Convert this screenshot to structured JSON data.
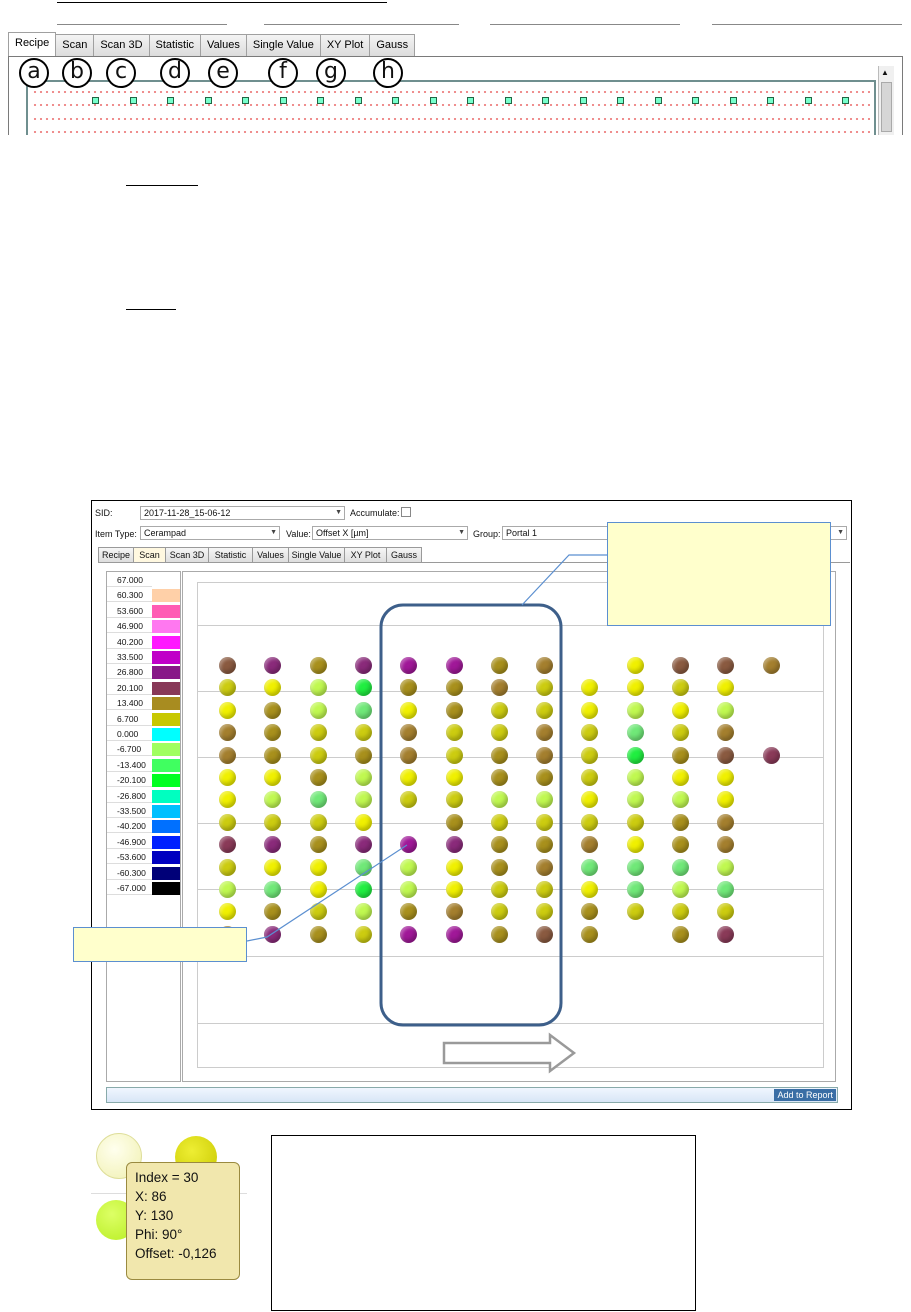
{
  "top_panel": {
    "tabs": [
      "Recipe",
      "Scan",
      "Scan 3D",
      "Statistic",
      "Values",
      "Single Value",
      "XY Plot",
      "Gauss"
    ],
    "active_tab": "Recipe",
    "markers": [
      "a",
      "b",
      "c",
      "d",
      "e",
      "f",
      "g",
      "h"
    ]
  },
  "screenshot": {
    "sid_label": "SID:",
    "sid_value": "2017-11-28_15-06-12",
    "accumulate_label": "Accumulate:",
    "item_type_label": "Item Type:",
    "item_type_value": "Cerampad",
    "value_label": "Value:",
    "value_value": "Offset X [µm]",
    "group_label": "Group:",
    "group_value": "Portal 1",
    "tabs": [
      "Recipe",
      "Scan",
      "Scan 3D",
      "Statistic",
      "Values",
      "Single Value",
      "XY Plot",
      "Gauss"
    ],
    "active_tab": "Scan",
    "add_to_report": "Add to Report",
    "scale": [
      {
        "label": "67.000",
        "color": "#ffffff"
      },
      {
        "label": "60.300",
        "color": "#ffd0a8"
      },
      {
        "label": "53.600",
        "color": "#ff5cb4"
      },
      {
        "label": "46.900",
        "color": "#ff78f0"
      },
      {
        "label": "40.200",
        "color": "#ff18ff"
      },
      {
        "label": "33.500",
        "color": "#c000c8"
      },
      {
        "label": "26.800",
        "color": "#881888"
      },
      {
        "label": "20.100",
        "color": "#883858"
      },
      {
        "label": "13.400",
        "color": "#a88c20"
      },
      {
        "label": "6.700",
        "color": "#c8c800"
      },
      {
        "label": "0.000",
        "color": "#00ffff"
      },
      {
        "label": "-6.700",
        "color": "#a0ff60"
      },
      {
        "label": "-13.400",
        "color": "#40ff60"
      },
      {
        "label": "-20.100",
        "color": "#00ff20"
      },
      {
        "label": "-26.800",
        "color": "#00ffc0"
      },
      {
        "label": "-33.500",
        "color": "#00c0ff"
      },
      {
        "label": "-40.200",
        "color": "#0070ff"
      },
      {
        "label": "-46.900",
        "color": "#0020ff"
      },
      {
        "label": "-53.600",
        "color": "#0000c0"
      },
      {
        "label": "-60.300",
        "color": "#000078"
      },
      {
        "label": "-67.000",
        "color": "#000000"
      }
    ],
    "grid_colors": {
      "B": "#8a5a40",
      "P": "#8a2a7a",
      "M": "#a01898",
      "O": "#a8901c",
      "D": "#a47f2e",
      "Y": "#f0f000",
      "G": "#cccc10",
      "L": "#c0f850",
      "T": "#70e878",
      "E": "#20ee40",
      "R": "#8a3a58"
    },
    "grid": [
      "BPOPMMOD.YBBD",
      "GYLEOODGYYGY",
      "YOLTYOGGYLYL",
      "DOGGDGGDGTGD",
      "DOGODGODGEOBR",
      "YYOLYYOOGLYY",
      "YLTLGGLLYLLY",
      "GGGY.OGGGGOD",
      "RPOPMPOODYOD",
      "GYYTLYODTTTL",
      "LTYELYGGYTLT",
      "YOGLODGGOGGG",
      "DPOGMMOBO.OR"
    ]
  },
  "tooltip": {
    "index": "Index = 30",
    "x": "X: 86",
    "y": "Y: 130",
    "phi": "Phi: 90°",
    "offset": "Offset: -0,126"
  }
}
